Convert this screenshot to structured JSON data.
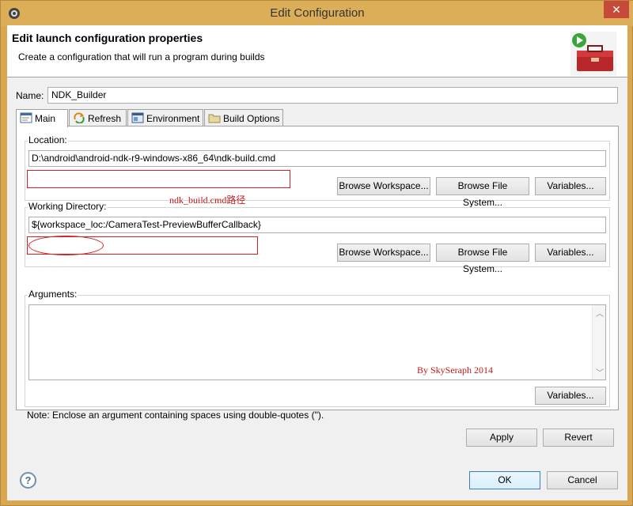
{
  "window": {
    "title": "Edit Configuration",
    "close_glyph": "✕"
  },
  "header": {
    "title": "Edit launch configuration properties",
    "description": "Create a configuration that will run a program during builds",
    "image_icon": "toolbox-run-icon"
  },
  "name": {
    "label": "Name:",
    "value": "NDK_Builder"
  },
  "tabs": [
    {
      "label": "Main",
      "icon": "main-tab-icon",
      "active": true
    },
    {
      "label": "Refresh",
      "icon": "refresh-icon",
      "active": false
    },
    {
      "label": "Environment",
      "icon": "environment-icon",
      "active": false
    },
    {
      "label": "Build Options",
      "icon": "folder-icon",
      "active": false
    }
  ],
  "location": {
    "label": "Location:",
    "value": "D:\\android\\android-ndk-r9-windows-x86_64\\ndk-build.cmd",
    "browse_workspace": "Browse Workspace...",
    "browse_file_system": "Browse File System...",
    "variables": "Variables...",
    "annotation": "ndk_build.cmd路径"
  },
  "working_directory": {
    "label": "Working Directory:",
    "value": "${workspace_loc:/CameraTest-PreviewBufferCallback}",
    "browse_workspace": "Browse Workspace...",
    "browse_file_system": "Browse File System...",
    "variables": "Variables..."
  },
  "arguments": {
    "label": "Arguments:",
    "value": "",
    "variables": "Variables...",
    "watermark": "By SkySeraph 2014",
    "note": "Note: Enclose an argument containing spaces using double-quotes (\")."
  },
  "panel_buttons": {
    "apply": "Apply",
    "revert": "Revert"
  },
  "dialog_buttons": {
    "help": "?",
    "ok": "OK",
    "cancel": "Cancel"
  },
  "colors": {
    "annotation_red": "#d42020",
    "title_bar": "#dcae58"
  }
}
